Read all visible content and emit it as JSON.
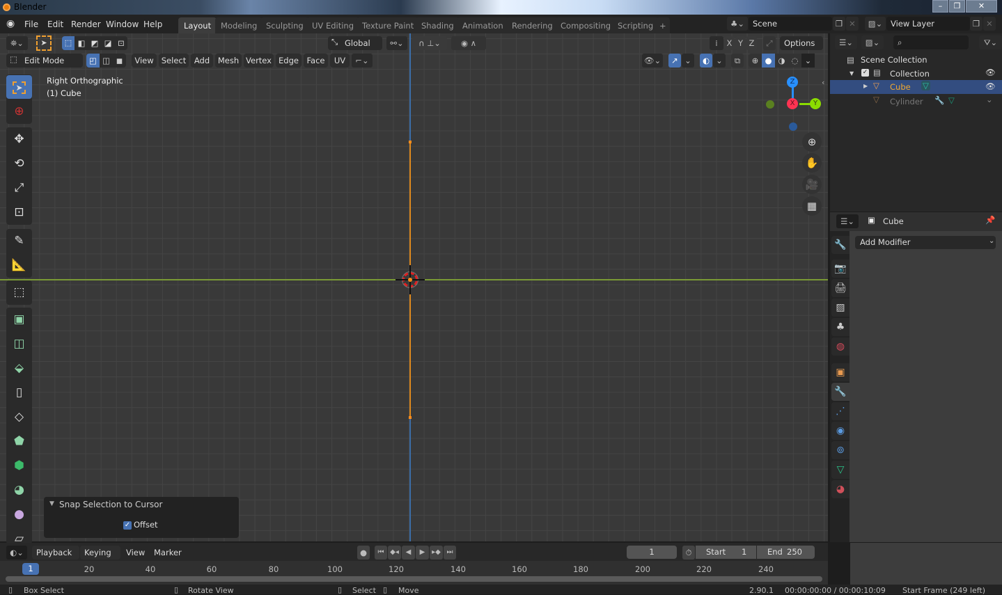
{
  "window": {
    "title": "Blender",
    "controls": [
      "minimize",
      "maximize",
      "close"
    ]
  },
  "menu": [
    "File",
    "Edit",
    "Render",
    "Window",
    "Help"
  ],
  "workspaces": {
    "tabs": [
      "Layout",
      "Modeling",
      "Sculpting",
      "UV Editing",
      "Texture Paint",
      "Shading",
      "Animation",
      "Rendering",
      "Compositing",
      "Scripting"
    ],
    "active": "Layout",
    "add": "+"
  },
  "scene": {
    "name": "Scene",
    "view_layer": "View Layer"
  },
  "viewport_header": {
    "orientation": "Global",
    "options": "Options",
    "axes": [
      "X",
      "Y",
      "Z"
    ],
    "mode": "Edit Mode",
    "menus": [
      "View",
      "Select",
      "Add",
      "Mesh",
      "Vertex",
      "Edge",
      "Face",
      "UV"
    ]
  },
  "viewport": {
    "view_name": "Right Orthographic",
    "object_label": "(1) Cube",
    "gizmo": {
      "z": "Z",
      "x": "X",
      "y": "Y"
    },
    "colors": {
      "x_axis": "#ff3352",
      "y_axis": "#8bdc00",
      "z_axis": "#2890ff",
      "edge": "#ff8c1a",
      "grid": "#393939"
    }
  },
  "operator_panel": {
    "title": "Snap Selection to Cursor",
    "offset_label": "Offset",
    "offset_checked": true
  },
  "outliner": {
    "root": "Scene Collection",
    "items": [
      {
        "name": "Collection",
        "level": 1,
        "visible": true
      },
      {
        "name": "Cube",
        "level": 2,
        "selected": true,
        "visible": true
      },
      {
        "name": "Cylinder",
        "level": 2,
        "selected": false,
        "visible": false
      }
    ]
  },
  "properties": {
    "object": "Cube",
    "add_modifier": "Add Modifier",
    "active_tab": "modifiers"
  },
  "timeline": {
    "menus": [
      "Playback",
      "Keying",
      "View",
      "Marker"
    ],
    "current_frame": "1",
    "start_label": "Start",
    "start": "1",
    "end_label": "End",
    "end": "250",
    "ticks": [
      "20",
      "40",
      "60",
      "80",
      "100",
      "120",
      "140",
      "160",
      "180",
      "200",
      "220",
      "240"
    ],
    "playhead": "1"
  },
  "statusbar": {
    "left": "Box Select",
    "mid1": "Rotate View",
    "mid2": "Select",
    "mid3": "Move",
    "version": "2.90.1",
    "time": "00:00:00:00 / 00:00:10:09",
    "info": "Start Frame (249 left)"
  }
}
